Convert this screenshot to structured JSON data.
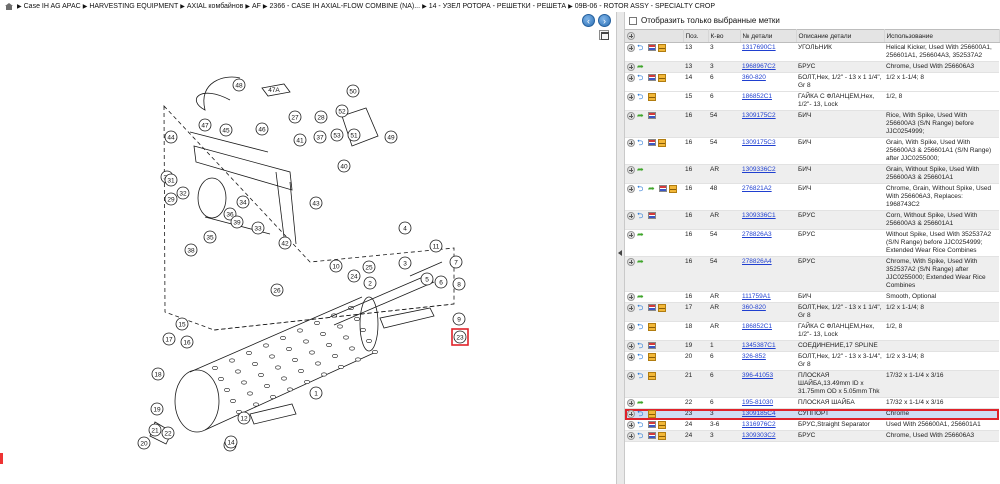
{
  "breadcrumb": {
    "items": [
      "Case IH AG APAC",
      "HARVESTING EQUIPMENT",
      "AXIAL комбайнов",
      "AF",
      "2366 - CASE IH AXIAL-FLOW COMBINE (NA)...",
      "14 - УЗЕЛ РОТОРА - РЕШЕТКИ - РЕШЕТА",
      "09B-06 - ROTOR ASSY - SPECIALTY CROP"
    ]
  },
  "nav": {
    "back_icon": "‹",
    "forward_icon": "›"
  },
  "diagram": {
    "callouts": [
      "1",
      "2",
      "3",
      "4",
      "5",
      "6",
      "7",
      "8",
      "9",
      "10",
      "11",
      "12",
      "13",
      "14",
      "15",
      "16",
      "17",
      "18",
      "19",
      "20",
      "21",
      "22",
      "23",
      "24",
      "25",
      "26",
      "27",
      "28",
      "29",
      "30",
      "31",
      "32",
      "33",
      "34",
      "35",
      "36",
      "37",
      "38",
      "39",
      "40",
      "41",
      "42",
      "43",
      "44",
      "45",
      "46",
      "47",
      "48",
      "49",
      "50",
      "51",
      "52",
      "53"
    ],
    "label_47a": "47A",
    "highlighted_callout": "23"
  },
  "filter": {
    "label": "Отобразить только выбранные метки",
    "checked": false
  },
  "table": {
    "headers": [
      "Поз.",
      "К-во",
      "№ детали",
      "Описание детали",
      "Использование"
    ],
    "rows": [
      {
        "icons": [
          "back",
          "flag",
          "box"
        ],
        "pos": "13",
        "qty": "3",
        "part": "1317690C1",
        "desc": "УГОЛЬНИК",
        "usage": "Helical Kicker, Used With 256600A1, 256601A1, 256604A3, 352537A2",
        "alt": false
      },
      {
        "icons": [
          "fwd"
        ],
        "pos": "13",
        "qty": "3",
        "part": "1968967C2",
        "desc": "БРУС",
        "usage": "Chrome, Used With 256606A3",
        "alt": true
      },
      {
        "icons": [
          "back",
          "flag",
          "box"
        ],
        "pos": "14",
        "qty": "6",
        "part": "360-820",
        "desc": "БОЛТ,Hex, 1/2\" - 13 x 1 1/4\", Gr 8",
        "usage": "1/2 x 1-1/4; 8",
        "alt": false
      },
      {
        "icons": [
          "back",
          "box"
        ],
        "pos": "15",
        "qty": "6",
        "part": "186852C1",
        "desc": "ГАЙКА С ФЛАНЦЕМ,Hex, 1/2\"- 13, Lock",
        "usage": "1/2, 8",
        "alt": false
      },
      {
        "icons": [
          "fwd",
          "flag"
        ],
        "pos": "16",
        "qty": "54",
        "part": "1309175C2",
        "desc": "БИЧ",
        "usage": "Rice, With Spike, Used With 256600A3 (S/N Range) before JJC0254999;",
        "alt": true
      },
      {
        "icons": [
          "back",
          "flag",
          "box"
        ],
        "pos": "16",
        "qty": "54",
        "part": "1309175C3",
        "desc": "БИЧ",
        "usage": "Grain, With Spike, Used With 256600A3 & 256601A1 (S/N Range) after JJC0255000;",
        "alt": false
      },
      {
        "icons": [
          "fwd"
        ],
        "pos": "16",
        "qty": "AR",
        "part": "1309336C2",
        "desc": "БИЧ",
        "usage": "Grain, Without Spike, Used With 256600A3 & 256601A1",
        "alt": true
      },
      {
        "icons": [
          "back",
          "fwd",
          "flag",
          "box"
        ],
        "pos": "16",
        "qty": "48",
        "part": "276821A2",
        "desc": "БИЧ",
        "usage": "Chrome, Grain, Without Spike, Used With 256606A3, Replaces: 1968743C2",
        "alt": false
      },
      {
        "icons": [
          "back",
          "flag"
        ],
        "pos": "16",
        "qty": "AR",
        "part": "1309336C1",
        "desc": "БРУС",
        "usage": "Corn, Without Spike, Used With 256600A3 & 256601A1",
        "alt": true
      },
      {
        "icons": [
          "fwd"
        ],
        "pos": "16",
        "qty": "54",
        "part": "278826A3",
        "desc": "БРУС",
        "usage": "Without Spike, Used With 352537A2 (S/N Range) before JJC0254999; Extended Wear Rice Combines",
        "alt": false
      },
      {
        "icons": [
          "fwd"
        ],
        "pos": "16",
        "qty": "54",
        "part": "278826A4",
        "desc": "БРУС",
        "usage": "Chrome, With Spike, Used With 352537A2 (S/N Range) after JJC0255000; Extended Wear Rice Combines",
        "alt": true
      },
      {
        "icons": [
          "fwd"
        ],
        "pos": "16",
        "qty": "AR",
        "part": "111759A1",
        "desc": "БИЧ",
        "usage": "Smooth, Optional",
        "alt": false
      },
      {
        "icons": [
          "back",
          "flag",
          "box"
        ],
        "pos": "17",
        "qty": "AR",
        "part": "360-820",
        "desc": "БОЛТ,Hex, 1/2\" - 13 x 1 1/4\", Gr 8",
        "usage": "1/2 x 1-1/4; 8",
        "alt": true
      },
      {
        "icons": [
          "back",
          "box"
        ],
        "pos": "18",
        "qty": "AR",
        "part": "186852C1",
        "desc": "ГАЙКА С ФЛАНЦЕМ,Hex, 1/2\"- 13, Lock",
        "usage": "1/2, 8",
        "alt": false
      },
      {
        "icons": [
          "back",
          "flag"
        ],
        "pos": "19",
        "qty": "1",
        "part": "1345387C1",
        "desc": "СОЕДИНЕНИЕ,17 SPLINE",
        "usage": "",
        "alt": true
      },
      {
        "icons": [
          "back",
          "box"
        ],
        "pos": "20",
        "qty": "6",
        "part": "326-852",
        "desc": "БОЛТ,Hex, 1/2\" - 13 x 3-1/4\", Gr 8",
        "usage": "1/2 x 3-1/4; 8",
        "alt": false
      },
      {
        "icons": [
          "back",
          "box"
        ],
        "pos": "21",
        "qty": "6",
        "part": "396-41053",
        "desc": "ПЛОСКАЯ ШАЙБА,13.49mm ID x 31.75mm OD x 5.05mm Thk",
        "usage": "17/32 x 1-1/4 x 3/16",
        "alt": true
      },
      {
        "icons": [
          "fwd"
        ],
        "pos": "22",
        "qty": "6",
        "part": "195-81030",
        "desc": "ПЛОСКАЯ ШАЙБА",
        "usage": "17/32 x 1-1/4 x 3/16",
        "alt": false
      },
      {
        "icons": [
          "back",
          "box"
        ],
        "pos": "23",
        "qty": "3",
        "part": "1309185C4",
        "desc": "СУППОРТ",
        "usage": "Chrome",
        "alt": false,
        "selected": true
      },
      {
        "icons": [
          "back",
          "flag",
          "box"
        ],
        "pos": "24",
        "qty": "3-6",
        "part": "1316976C2",
        "desc": "БРУС,Straight Separator",
        "usage": "Used With 256600A1, 256601A1",
        "alt": false
      },
      {
        "icons": [
          "back",
          "flag",
          "box"
        ],
        "pos": "24",
        "qty": "3",
        "part": "1309303C2",
        "desc": "БРУС",
        "usage": "Chrome, Used With 256606A3",
        "alt": true
      }
    ]
  },
  "colors": {
    "link": "#1f3fd0",
    "selection_outline": "#e0222a",
    "selected_row": "#cfdcf3",
    "header_bg": "#e4e4e4"
  }
}
